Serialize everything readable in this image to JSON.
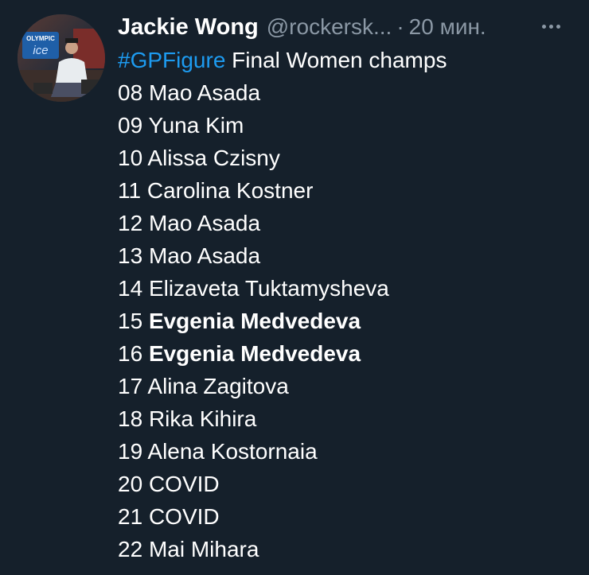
{
  "tweet": {
    "author_name": "Jackie Wong",
    "author_handle": "@rockersk...",
    "separator": "·",
    "timestamp": "20 мин.",
    "hashtag": "#GPFigure",
    "title_rest": " Final Women champs",
    "lines": [
      {
        "year": "08",
        "name": "Mao Asada"
      },
      {
        "year": "09",
        "name": "Yuna Kim"
      },
      {
        "year": "10",
        "name": "Alissa Czisny"
      },
      {
        "year": "11",
        "name": "Carolina Kostner"
      },
      {
        "year": "12",
        "name": "Mao Asada"
      },
      {
        "year": "13",
        "name": "Mao Asada"
      },
      {
        "year": "14",
        "name": "Elizaveta Tuktamysheva"
      },
      {
        "year": "15",
        "name": "Evgenia Medvedeva"
      },
      {
        "year": "16",
        "name": "Evgenia Medvedeva"
      },
      {
        "year": "17",
        "name": "Alina Zagitova"
      },
      {
        "year": "18",
        "name": "Rika Kihira"
      },
      {
        "year": "19",
        "name": "Alena Kostornaia"
      },
      {
        "year": "20",
        "name": "COVID"
      },
      {
        "year": "21",
        "name": "COVID"
      },
      {
        "year": "22",
        "name": "Mai Mihara"
      }
    ],
    "avatar_logo_text": [
      "OLYMPIC",
      "ice"
    ]
  },
  "colors": {
    "background": "#15202b",
    "text": "#ffffff",
    "muted": "#8b98a5",
    "accent": "#1d9bf0"
  }
}
